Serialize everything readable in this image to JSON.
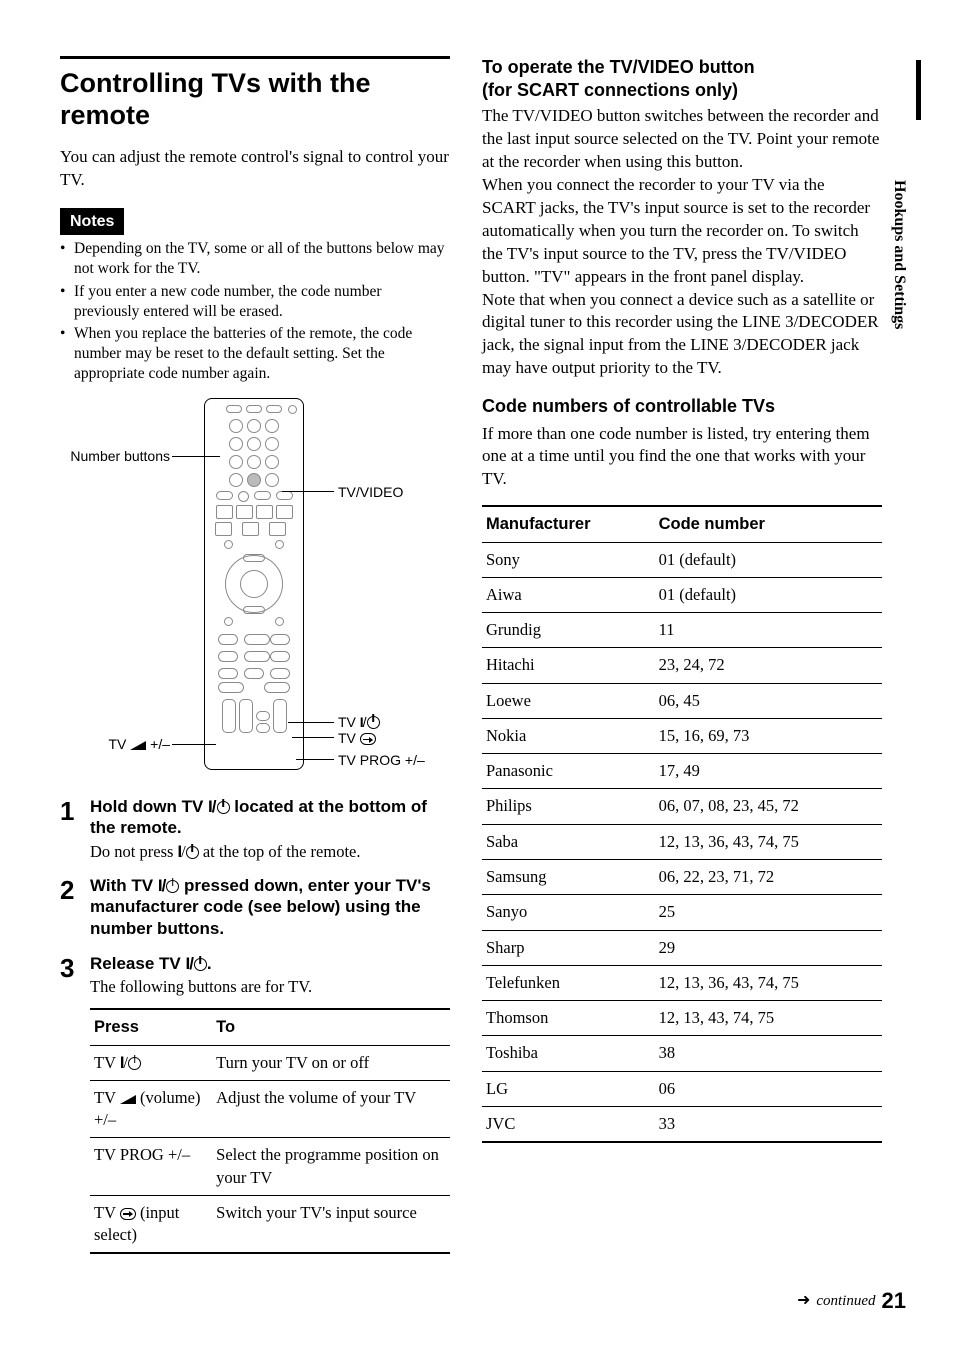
{
  "side_tab": "Hookups and Settings",
  "left": {
    "title": "Controlling TVs with the remote",
    "intro": "You can adjust the remote control's signal to control your TV.",
    "notes_label": "Notes",
    "notes": [
      "Depending on the TV, some or all of the buttons below may not work for the TV.",
      "If you enter a new code number, the code number previously entered will be erased.",
      "When you replace the batteries of the remote, the code number may be reset to the default setting. Set the appropriate code number again."
    ],
    "callouts": {
      "number_buttons": "Number buttons",
      "tv_video": "TV/VIDEO",
      "tv_power": "TV ",
      "tv_input": "TV ",
      "tv_vol": "TV ",
      "tv_prog": "TV PROG +/–",
      "vol_suffix": " +/–"
    },
    "steps": [
      {
        "head_pre": "Hold down TV ",
        "head_post": " located at the bottom of the remote.",
        "sub_pre": "Do not press ",
        "sub_post": " at the top of the remote."
      },
      {
        "head_pre": "With TV ",
        "head_post": " pressed down, enter your TV's manufacturer code (see below) using the number buttons."
      },
      {
        "head_pre": "Release TV ",
        "head_post": ".",
        "sub_plain": "The following buttons are for TV."
      }
    ],
    "fn_table": {
      "headers": [
        "Press",
        "To"
      ],
      "rows": [
        {
          "press_pre": "TV ",
          "press_kind": "power",
          "to": "Turn your TV on or off"
        },
        {
          "press_pre": "TV ",
          "press_kind": "vol",
          "press_post": " (volume) +/–",
          "to": "Adjust the volume of your TV"
        },
        {
          "press_plain": "TV PROG +/–",
          "to": "Select the programme position on your TV"
        },
        {
          "press_pre": "TV ",
          "press_kind": "input",
          "press_post": " (input select)",
          "to": "Switch your TV's input source"
        }
      ]
    }
  },
  "right": {
    "h2a": "To operate the TV/VIDEO button",
    "h2b": "(for SCART connections only)",
    "p1": "The TV/VIDEO button switches between the recorder and the last input source selected on the TV. Point your remote at the recorder when using this button.",
    "p2": "When you connect the recorder to your TV via the SCART jacks, the TV's input source is set to the recorder automatically when you turn the recorder on. To switch the TV's input source to the TV, press the TV/VIDEO button. \"TV\" appears in the front panel display.",
    "p3": "Note that when you connect a device such as a satellite or digital tuner to this recorder using the LINE 3/DECODER jack, the signal input from the LINE 3/DECODER jack may have output priority to the TV.",
    "h3": "Code numbers of controllable TVs",
    "p4": "If more than one code number is listed, try entering them one at a time until you find the one that works with your TV.",
    "code_table": {
      "headers": [
        "Manufacturer",
        "Code number"
      ],
      "rows": [
        {
          "m": "Sony",
          "c": "01 (default)"
        },
        {
          "m": "Aiwa",
          "c": "01 (default)"
        },
        {
          "m": "Grundig",
          "c": "11"
        },
        {
          "m": "Hitachi",
          "c": "23, 24, 72"
        },
        {
          "m": "Loewe",
          "c": "06, 45"
        },
        {
          "m": "Nokia",
          "c": "15, 16, 69, 73"
        },
        {
          "m": "Panasonic",
          "c": "17, 49"
        },
        {
          "m": "Philips",
          "c": "06, 07, 08, 23, 45, 72"
        },
        {
          "m": "Saba",
          "c": "12, 13, 36, 43, 74, 75"
        },
        {
          "m": "Samsung",
          "c": "06, 22, 23, 71, 72"
        },
        {
          "m": "Sanyo",
          "c": "25"
        },
        {
          "m": "Sharp",
          "c": "29"
        },
        {
          "m": "Telefunken",
          "c": "12, 13, 36, 43, 74, 75"
        },
        {
          "m": "Thomson",
          "c": "12, 13, 43, 74, 75"
        },
        {
          "m": "Toshiba",
          "c": "38"
        },
        {
          "m": "LG",
          "c": "06"
        },
        {
          "m": "JVC",
          "c": "33"
        }
      ]
    }
  },
  "footer": {
    "arrow": "➜",
    "continued": "continued",
    "page": "21"
  }
}
